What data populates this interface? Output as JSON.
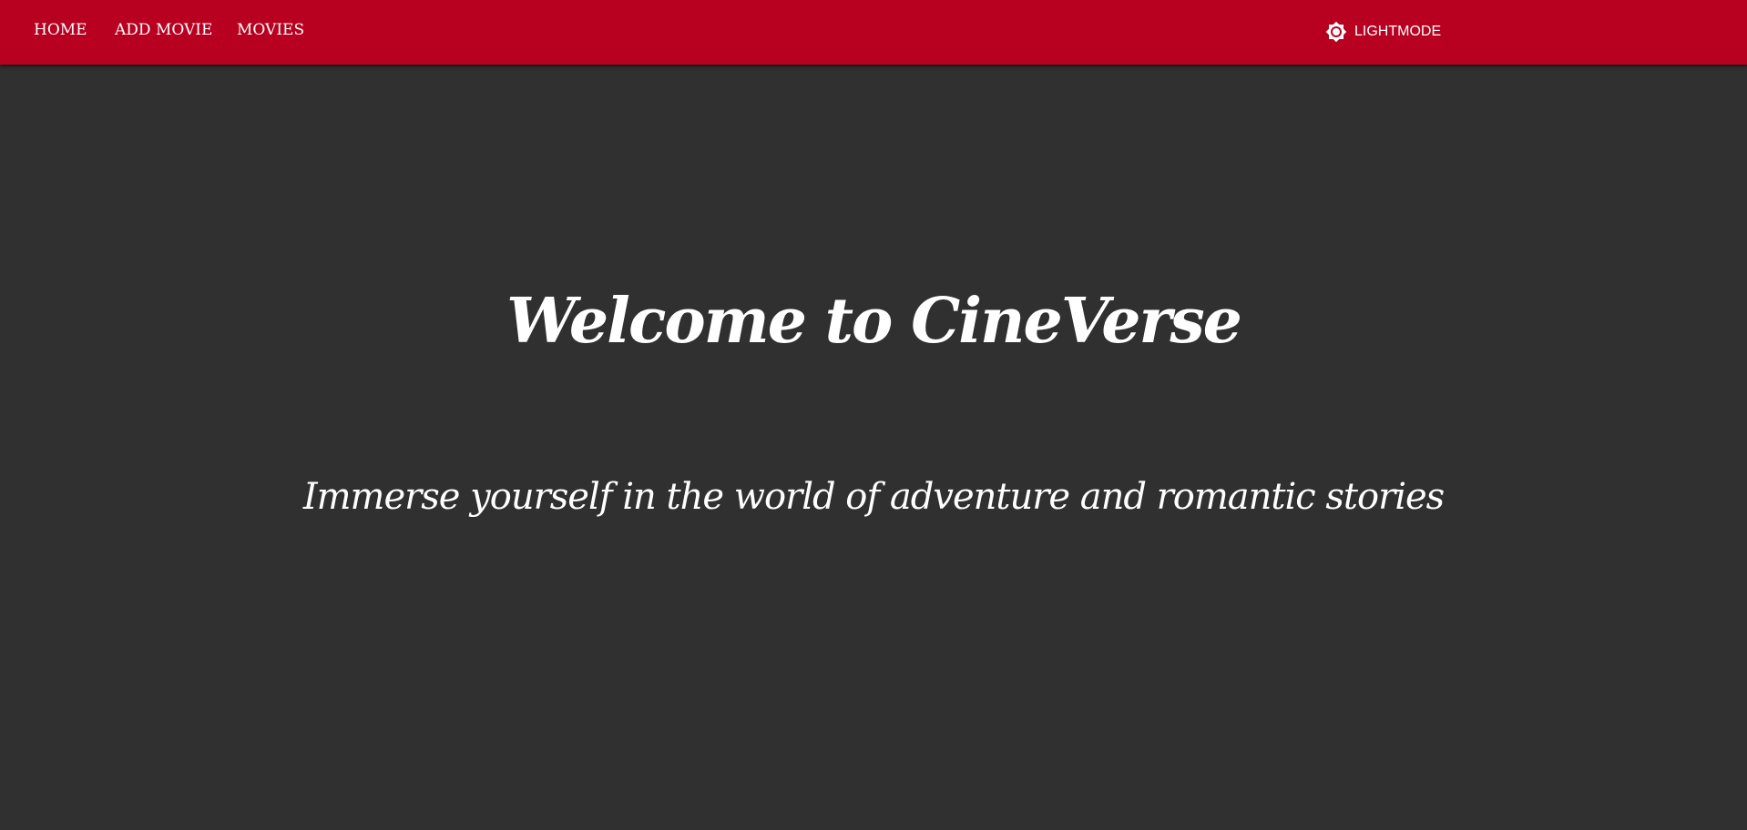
{
  "nav": {
    "home_label": "HOME",
    "add_movie_label": "ADD MOVIE",
    "movies_label": "MOVIES"
  },
  "theme_toggle": {
    "label": "LIGHTMODE",
    "icon": "brightness-icon"
  },
  "hero": {
    "title": "Welcome to CineVerse",
    "subtitle": "Immerse yourself in the world of adventure and romantic stories"
  },
  "colors": {
    "app_bar": "#b80020",
    "background": "#303030",
    "text": "#ffffff"
  }
}
